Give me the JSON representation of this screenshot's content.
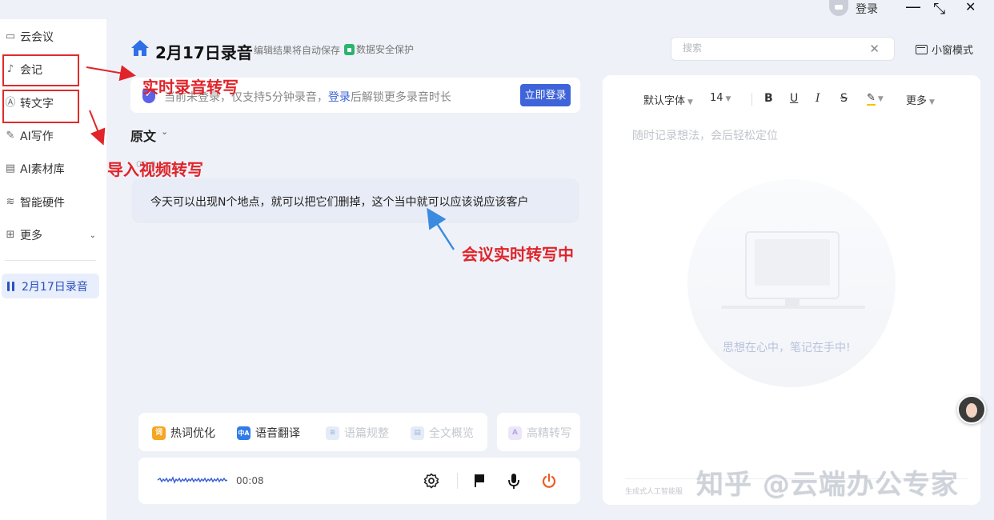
{
  "titlebar": {
    "login_label": "登录",
    "minimize": "—",
    "restore": "⤡",
    "close": "✕"
  },
  "sidebar": {
    "items": [
      {
        "label": "云会议",
        "icon": "video-icon"
      },
      {
        "label": "会记",
        "icon": "microphone-icon"
      },
      {
        "label": "转文字",
        "icon": "transcribe-icon"
      },
      {
        "label": "AI写作",
        "icon": "edit-icon"
      },
      {
        "label": "AI素材库",
        "icon": "folder-icon"
      },
      {
        "label": "智能硬件",
        "icon": "layers-icon"
      },
      {
        "label": "更多",
        "icon": "grid-icon"
      }
    ],
    "current_recording": "2月17日录音"
  },
  "annotations": {
    "realtime_recording": "实时录音转写",
    "import_video": "导入视频转写",
    "meeting_realtime": "会议实时转写中",
    "color": "#e0242a"
  },
  "header": {
    "title": "2月17日录音",
    "autosave": "编辑结果将自动保存",
    "secure": "数据安全保护",
    "search_placeholder": "搜索",
    "mini_window": "小窗模式"
  },
  "banner": {
    "text_before": "当前未登录，仅支持5分钟录音，",
    "link": "登录",
    "text_after": "后解锁更多录音时长",
    "button": "立即登录"
  },
  "transcript": {
    "section_label": "原文",
    "time_label": "00:0",
    "text": "今天可以出现N个地点，就可以把它们删掉，这个当中就可以应该说应该客户"
  },
  "tools": [
    {
      "label": "热词优化",
      "icon_text": "词",
      "enabled": true
    },
    {
      "label": "语音翻译",
      "icon_text": "中A",
      "enabled": true
    },
    {
      "label": "语篇规整",
      "icon_text": "≡",
      "enabled": false
    },
    {
      "label": "全文概览",
      "icon_text": "▤",
      "enabled": false
    },
    {
      "label": "高精转写",
      "icon_text": "A",
      "enabled": false
    }
  ],
  "player": {
    "elapsed": "00:08"
  },
  "editor": {
    "font": "默认字体",
    "size": "14",
    "more": "更多",
    "placeholder": "随时记录想法，会后轻松定位",
    "slogan": "思想在心中，笔记在手中!",
    "disclaimer": "生成式人工智能服"
  },
  "watermark": "知乎 @云端办公专家"
}
